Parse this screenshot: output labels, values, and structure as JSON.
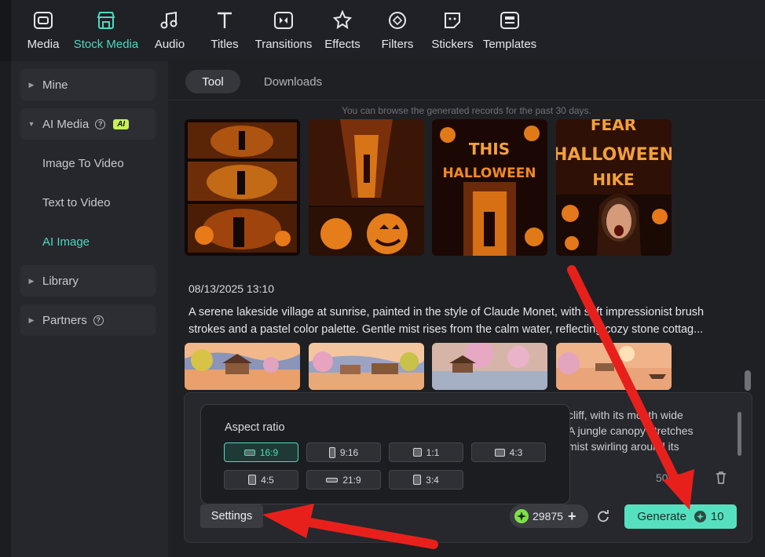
{
  "toolbar": {
    "items": [
      {
        "label": "Media",
        "icon": "media-icon"
      },
      {
        "label": "Stock Media",
        "icon": "stock-media-icon"
      },
      {
        "label": "Audio",
        "icon": "audio-icon"
      },
      {
        "label": "Titles",
        "icon": "titles-icon"
      },
      {
        "label": "Transitions",
        "icon": "transitions-icon"
      },
      {
        "label": "Effects",
        "icon": "effects-icon"
      },
      {
        "label": "Filters",
        "icon": "filters-icon"
      },
      {
        "label": "Stickers",
        "icon": "stickers-icon"
      },
      {
        "label": "Templates",
        "icon": "templates-icon"
      }
    ],
    "active": "Stock Media"
  },
  "sidebar": {
    "items": [
      {
        "label": "Mine"
      },
      {
        "label": "AI Media",
        "badge": "AI"
      },
      {
        "label": "Image To Video"
      },
      {
        "label": "Text to Video"
      },
      {
        "label": "AI Image"
      },
      {
        "label": "Library"
      },
      {
        "label": "Partners"
      }
    ]
  },
  "tabs": {
    "tool": "Tool",
    "downloads": "Downloads",
    "active": "Tool"
  },
  "notice": "You can browse the generated records for the past 30 days.",
  "record": {
    "timestamp": "08/13/2025 13:10",
    "prompt_line1": "A serene lakeside village at sunrise, painted in the style of Claude Monet, with soft impressionist brush",
    "prompt_line2": "strokes and a pastel color palette. Gentle mist rises from the calm water, reflecting cozy stone cottag..."
  },
  "halloween_thumbs": {
    "t3_text": "THIS HALLOWEEN",
    "t4_text": "FEAR HALLOWEEN HIKE"
  },
  "input_panel": {
    "text_line1": "cliff, with its mouth wide",
    "text_line2": "A jungle canopy stretches",
    "text_line3": "mist swirling around its",
    "char_count": "500"
  },
  "aspect": {
    "title": "Aspect ratio",
    "options": [
      "16:9",
      "9:16",
      "1:1",
      "4:3",
      "4:5",
      "21:9",
      "3:4"
    ],
    "selected": "16:9"
  },
  "controls": {
    "settings": "Settings",
    "credits": "29875",
    "generate": "Generate",
    "generate_cost": "10"
  },
  "colors": {
    "accent": "#4fd8bd",
    "generate_bg": "#57e0c0",
    "arrow": "#e8201c"
  }
}
